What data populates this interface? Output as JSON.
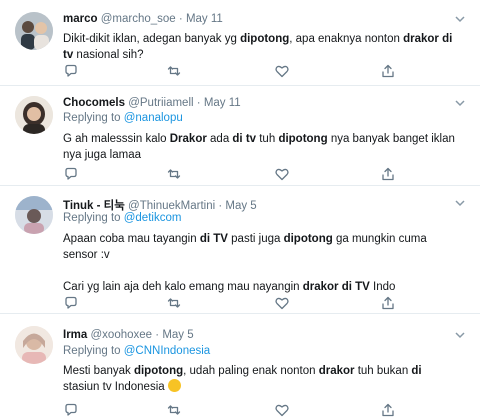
{
  "tweets": [
    {
      "display_name": "marco",
      "handle": "@marcho_soe",
      "sep": "·",
      "date": "May 11",
      "reply_prefix": "",
      "reply_handle": "",
      "lines": [
        [
          {
            "t": "Dikit-dikit iklan, adegan banyak yg "
          },
          {
            "t": "dipotong",
            "b": true
          },
          {
            "t": ", apa enaknya nonton "
          },
          {
            "t": "drakor di",
            "b": true
          }
        ],
        [
          {
            "t": "tv",
            "b": true
          },
          {
            "t": " nasional sih?"
          }
        ]
      ]
    },
    {
      "display_name": "Chocomels",
      "handle": "@Putriiamell",
      "sep": "·",
      "date": "May 11",
      "reply_prefix": "Replying to ",
      "reply_handle": "@nanalopu",
      "lines": [
        [
          {
            "t": "G ah malesssin kalo "
          },
          {
            "t": "Drakor",
            "b": true
          },
          {
            "t": " ada "
          },
          {
            "t": "di tv",
            "b": true
          },
          {
            "t": " tuh "
          },
          {
            "t": "dipotong",
            "b": true
          },
          {
            "t": " nya banyak banget iklan"
          }
        ],
        [
          {
            "t": "nya juga lamaa"
          }
        ]
      ]
    },
    {
      "display_name": "Tinuk - 티눅",
      "handle": "@ThinuekMartini",
      "sep": "·",
      "date": "May 5",
      "reply_prefix": "Replying to ",
      "reply_handle": "@detikcom",
      "lines": [
        [
          {
            "t": "Apaan coba mau tayangin "
          },
          {
            "t": "di TV",
            "b": true
          },
          {
            "t": " pasti juga "
          },
          {
            "t": "dipotong",
            "b": true
          },
          {
            "t": " ga mungkin cuma"
          }
        ],
        [
          {
            "t": "sensor :v"
          }
        ],
        [
          {
            "t": ""
          }
        ],
        [
          {
            "t": "Cari yg lain aja deh kalo emang mau nayangin "
          },
          {
            "t": "drakor di TV",
            "b": true
          },
          {
            "t": " Indo"
          }
        ]
      ]
    },
    {
      "display_name": "Irma",
      "handle": "@xoohoxee",
      "sep": "·",
      "date": "May 5",
      "reply_prefix": "Replying to ",
      "reply_handle": "@CNNIndonesia",
      "lines": [
        [
          {
            "t": "Mesti banyak "
          },
          {
            "t": "dipotong",
            "b": true
          },
          {
            "t": ", udah paling enak nonton "
          },
          {
            "t": "drakor",
            "b": true
          },
          {
            "t": " tuh bukan "
          },
          {
            "t": "di",
            "b": true
          }
        ],
        [
          {
            "t": "stasiun tv Indonesia "
          }
        ]
      ],
      "emoji": "🙃"
    }
  ],
  "icons": {
    "reply": "reply-icon",
    "retweet": "retweet-icon",
    "like": "heart-icon",
    "share": "share-icon",
    "menu": "chevron-down-icon"
  },
  "colors": {
    "text": "#14171a",
    "muted": "#657786",
    "link": "#1b95e0",
    "divider": "#e6ecf0"
  }
}
